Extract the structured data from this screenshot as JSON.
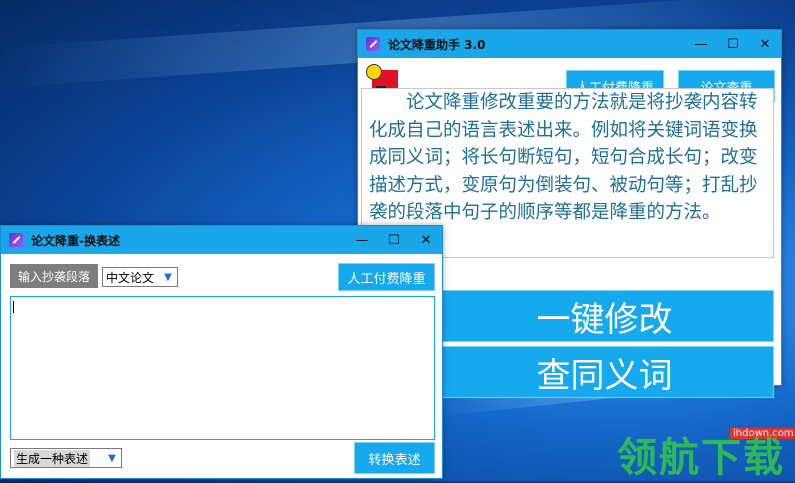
{
  "main_window": {
    "title": "论文降重助手 3.0",
    "manual_button": "人工付费降重",
    "check_button": "论文查重",
    "description": "论文降重修改重要的方法就是将抄袭内容转化成自己的语言表述出来。例如将关键词语变换成同义词；将长句断短句，短句合成长句；改变描述方式，变原句为倒装句、被动句等；打乱抄袭的段落中句子的顺序等都是降重的方法。",
    "one_click_button": "一键修改",
    "synonym_button": "查同义词"
  },
  "sub_window": {
    "title": "论文降重-换表述",
    "input_tab": "输入抄袭段落",
    "language_select": "中文论文",
    "manual_button": "人工付费降重",
    "text_value": "",
    "mode_select": "生成一种表述",
    "convert_button": "转换表述"
  },
  "window_controls": {
    "minimize": "—",
    "maximize": "☐",
    "close": "✕"
  },
  "watermark": {
    "text": "领航下载",
    "site": "ihdown.com"
  },
  "colors": {
    "accent": "#19a7ea",
    "text_blue": "#1f6f97",
    "tag_gray": "#7d7d7d"
  }
}
